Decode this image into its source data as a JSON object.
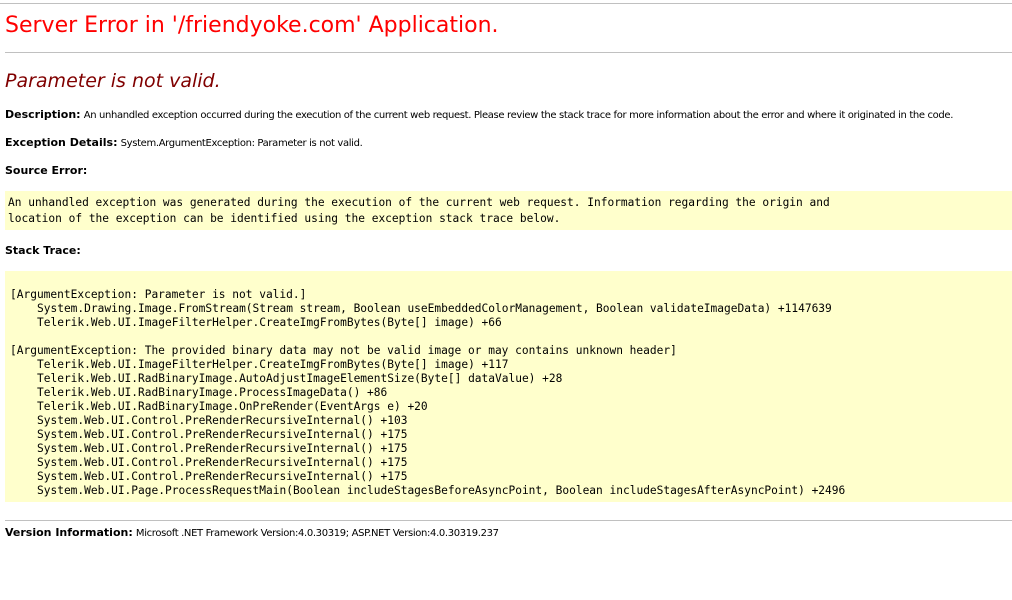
{
  "page": {
    "title": "Server Error in '/friendyoke.com' Application.",
    "error_heading": "Parameter is not valid."
  },
  "description": {
    "label": "Description:",
    "text": "An unhandled exception occurred during the execution of the current web request. Please review the stack trace for more information about the error and where it originated in the code."
  },
  "exception_details": {
    "label": "Exception Details:",
    "text": "System.ArgumentException: Parameter is not valid."
  },
  "source_error": {
    "label": "Source Error:",
    "lines": [
      "An unhandled exception was generated during the execution of the current web request. Information regarding the origin and",
      "location of the exception can be identified using the exception stack trace below."
    ]
  },
  "stack_trace": {
    "label": "Stack Trace:",
    "groups": [
      {
        "header": "[ArgumentException: Parameter is not valid.]",
        "frames": [
          "System.Drawing.Image.FromStream(Stream stream, Boolean useEmbeddedColorManagement, Boolean validateImageData) +1147639",
          "Telerik.Web.UI.ImageFilterHelper.CreateImgFromBytes(Byte[] image) +66"
        ]
      },
      {
        "header": "[ArgumentException: The provided binary data may not be valid image or may contains unknown header]",
        "frames": [
          "Telerik.Web.UI.ImageFilterHelper.CreateImgFromBytes(Byte[] image) +117",
          "Telerik.Web.UI.RadBinaryImage.AutoAdjustImageElementSize(Byte[] dataValue) +28",
          "Telerik.Web.UI.RadBinaryImage.ProcessImageData() +86",
          "Telerik.Web.UI.RadBinaryImage.OnPreRender(EventArgs e) +20",
          "System.Web.UI.Control.PreRenderRecursiveInternal() +103",
          "System.Web.UI.Control.PreRenderRecursiveInternal() +175",
          "System.Web.UI.Control.PreRenderRecursiveInternal() +175",
          "System.Web.UI.Control.PreRenderRecursiveInternal() +175",
          "System.Web.UI.Control.PreRenderRecursiveInternal() +175",
          "System.Web.UI.Page.ProcessRequestMain(Boolean includeStagesBeforeAsyncPoint, Boolean includeStagesAfterAsyncPoint) +2496"
        ]
      }
    ]
  },
  "version_info": {
    "label": "Version Information:",
    "text": "Microsoft .NET Framework Version:4.0.30319; ASP.NET Version:4.0.30319.237"
  },
  "colors": {
    "title": "#ff0000",
    "error_heading": "#800000",
    "code_background": "#ffffcc",
    "rule": "#c0c0c0"
  }
}
